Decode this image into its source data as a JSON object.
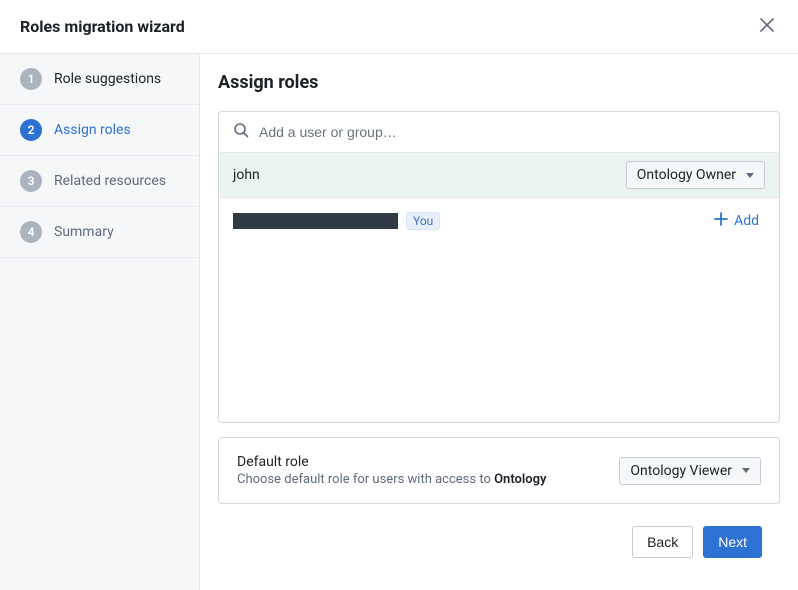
{
  "header": {
    "title": "Roles migration wizard"
  },
  "steps": [
    {
      "num": "1",
      "label": "Role suggestions"
    },
    {
      "num": "2",
      "label": "Assign roles"
    },
    {
      "num": "3",
      "label": "Related resources"
    },
    {
      "num": "4",
      "label": "Summary"
    }
  ],
  "activeStepIndex": 1,
  "main": {
    "title": "Assign roles",
    "search": {
      "placeholder": "Add a user or group…",
      "value": ""
    },
    "users": {
      "selected": {
        "name": "john",
        "role": "Ontology Owner"
      },
      "me": {
        "youBadge": "You",
        "addLabel": "Add"
      }
    },
    "defaultRole": {
      "title": "Default role",
      "descPrefix": "Choose default role for users with access to ",
      "descStrong": "Ontology",
      "selected": "Ontology Viewer"
    }
  },
  "footer": {
    "back": "Back",
    "next": "Next"
  }
}
